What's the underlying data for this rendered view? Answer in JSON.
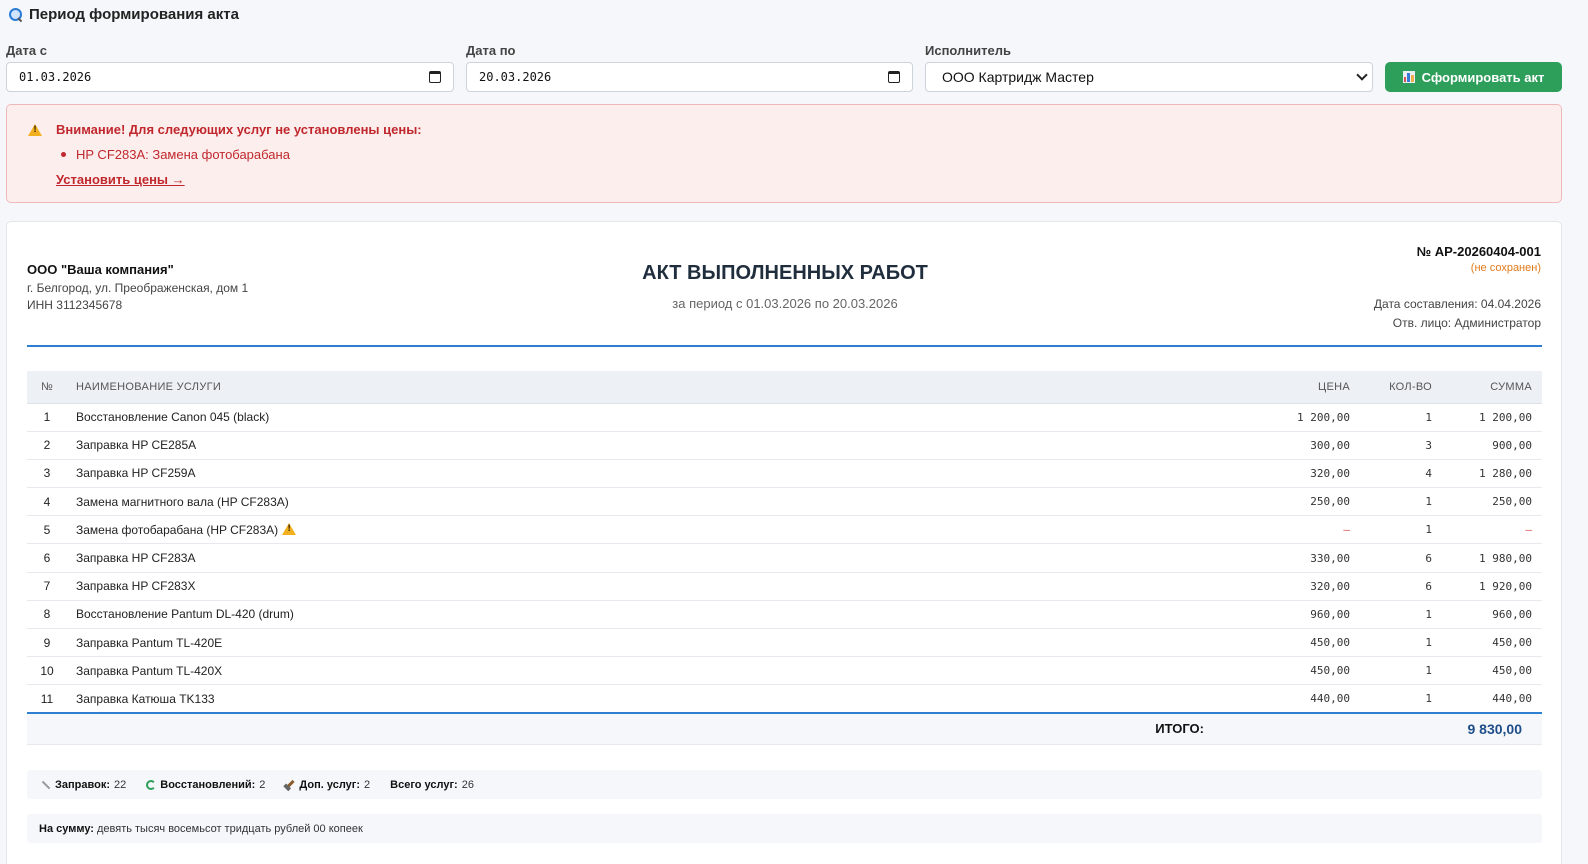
{
  "period": {
    "title": "Период формирования акта",
    "date_from_label": "Дата с",
    "date_from_value": "01.03.2026",
    "date_to_label": "Дата по",
    "date_to_value": "20.03.2026",
    "executor_label": "Исполнитель",
    "executor_value": "ООО Картридж Мастер",
    "generate_button": "Сформировать акт"
  },
  "alert": {
    "title": "Внимание! Для следующих услуг не установлены цены:",
    "items": [
      "HP CF283A: Замена фотобарабана"
    ],
    "link": "Установить цены →"
  },
  "act": {
    "company_name": "ООО \"Ваша компания\"",
    "company_address": "г. Белгород, ул. Преображенская, дом 1",
    "company_inn": "ИНН 3112345678",
    "title": "АКТ ВЫПОЛНЕННЫХ РАБОТ",
    "period_text": "за период с 01.03.2026 по 20.03.2026",
    "number": "№ АР-20260404-001",
    "unsaved": "(не сохранен)",
    "date": "Дата составления: 04.04.2026",
    "responsible": "Отв. лицо: Администратор"
  },
  "table": {
    "headers": {
      "num": "№",
      "name": "НАИМЕНОВАНИЕ УСЛУГИ",
      "price": "ЦЕНА",
      "qty": "КОЛ-ВО",
      "sum": "СУММА"
    },
    "rows": [
      {
        "num": "1",
        "name": "Восстановление Canon 045 (black)",
        "price": "1 200,00",
        "qty": "1",
        "sum": "1 200,00"
      },
      {
        "num": "2",
        "name": "Заправка HP CE285A",
        "price": "300,00",
        "qty": "3",
        "sum": "900,00"
      },
      {
        "num": "3",
        "name": "Заправка HP CF259A",
        "price": "320,00",
        "qty": "4",
        "sum": "1 280,00"
      },
      {
        "num": "4",
        "name": "Замена магнитного вала (HP CF283A)",
        "price": "250,00",
        "qty": "1",
        "sum": "250,00"
      },
      {
        "num": "5",
        "name": "Замена фотобарабана (HP CF283A)",
        "price": "—",
        "qty": "1",
        "sum": "—"
      },
      {
        "num": "6",
        "name": "Заправка HP CF283A",
        "price": "330,00",
        "qty": "6",
        "sum": "1 980,00"
      },
      {
        "num": "7",
        "name": "Заправка HP CF283X",
        "price": "320,00",
        "qty": "6",
        "sum": "1 920,00"
      },
      {
        "num": "8",
        "name": "Восстановление Pantum DL-420 (drum)",
        "price": "960,00",
        "qty": "1",
        "sum": "960,00"
      },
      {
        "num": "9",
        "name": "Заправка Pantum TL-420E",
        "price": "450,00",
        "qty": "1",
        "sum": "450,00"
      },
      {
        "num": "10",
        "name": "Заправка Pantum TL-420X",
        "price": "450,00",
        "qty": "1",
        "sum": "450,00"
      },
      {
        "num": "11",
        "name": "Заправка Катюша TK133",
        "price": "440,00",
        "qty": "1",
        "sum": "440,00"
      }
    ],
    "total_label": "ИТОГО:",
    "total_value": "9 830,00"
  },
  "stats": {
    "refills_label": "Заправок:",
    "refills_value": "22",
    "restore_label": "Восстановлений:",
    "restore_value": "2",
    "extra_label": "Доп. услуг:",
    "extra_value": "2",
    "total_label": "Всего услуг:",
    "total_value": "26"
  },
  "sum_words": {
    "label": "На сумму:",
    "value": "девять тысяч восемьсот тридцать рублей 00 копеек"
  },
  "colors": {
    "accent_blue": "#2e7fd1",
    "success_green": "#2e9e5b",
    "alert_red": "#c0282d",
    "warning_orange": "#e07b1a"
  },
  "icons": {
    "period_title": "magnifier-icon",
    "date_picker": "calendar-icon",
    "select": "chevron-down-icon",
    "generate_button": "bar-chart-icon",
    "alert": "warning-icon",
    "refills": "brush-icon",
    "restore": "recycle-icon",
    "extra": "hammer-icon"
  }
}
